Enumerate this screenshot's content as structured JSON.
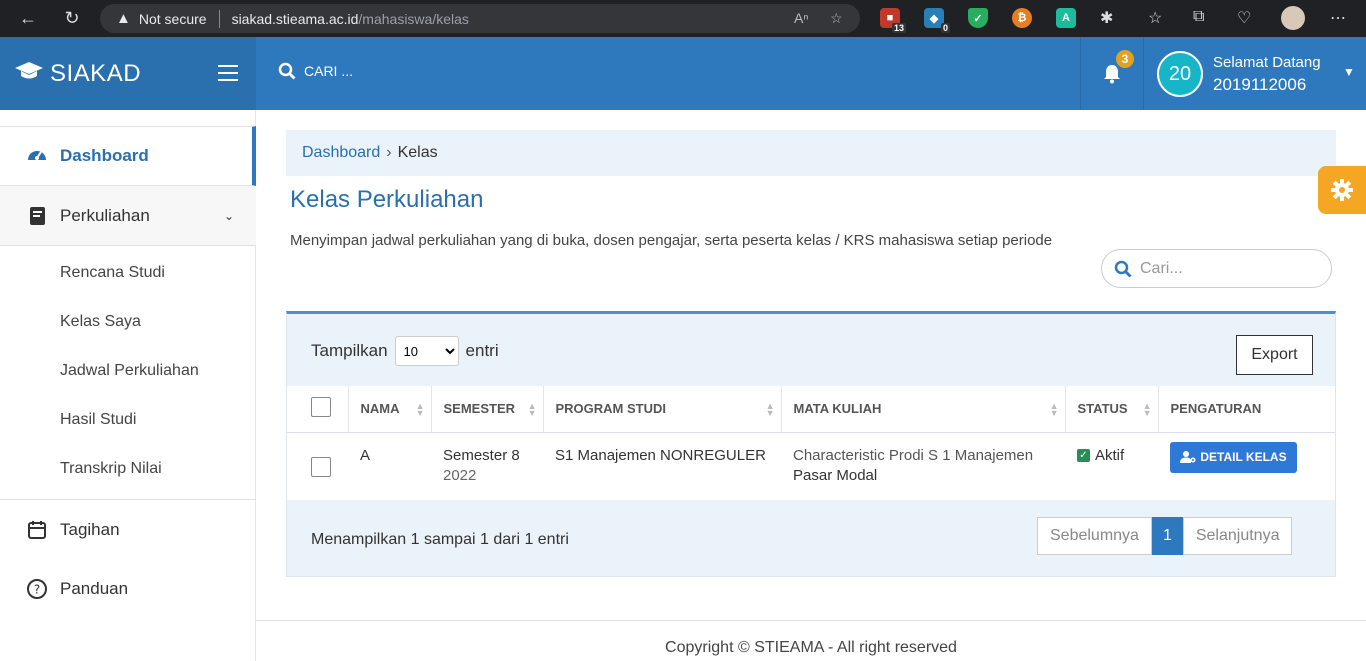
{
  "browser": {
    "not_secure": "Not secure",
    "host": "siakad.stieama.ac.id",
    "path": "/mahasiswa/kelas",
    "ext_badge_1": "13",
    "ext_badge_2": "0"
  },
  "header": {
    "brand": "SIAKAD",
    "search_placeholder": "CARI ...",
    "notif_count": "3",
    "avatar_text": "20",
    "greeting": "Selamat Datang",
    "user_id": "2019112006"
  },
  "sidebar": {
    "dashboard": "Dashboard",
    "perkuliahan": "Perkuliahan",
    "sub": [
      "Rencana Studi",
      "Kelas Saya",
      "Jadwal Perkuliahan",
      "Hasil Studi",
      "Transkrip Nilai"
    ],
    "tagihan": "Tagihan",
    "panduan": "Panduan"
  },
  "breadcrumb": {
    "home": "Dashboard",
    "sep": "›",
    "current": "Kelas"
  },
  "page": {
    "title": "Kelas Perkuliahan",
    "description": "Menyimpan jadwal perkuliahan yang di buka, dosen pengajar, serta peserta kelas / KRS mahasiswa setiap periode",
    "search_placeholder": "Cari..."
  },
  "table_controls": {
    "show_label": "Tampilkan",
    "show_value": "10",
    "entries_label": "entri",
    "export": "Export"
  },
  "table": {
    "headers": [
      "NAMA",
      "SEMESTER",
      "PROGRAM STUDI",
      "MATA KULIAH",
      "STATUS",
      "PENGATURAN"
    ],
    "rows": [
      {
        "nama": "A",
        "semester": "Semester 8",
        "tahun": "2022",
        "prodi": "S1 Manajemen NONREGULER",
        "mk_kode": "Characteristic Prodi S 1 Manajemen",
        "mk_nama": "Pasar Modal",
        "status": "Aktif",
        "action": "DETAIL KELAS"
      }
    ]
  },
  "footer_info": {
    "summary": "Menampilkan 1 sampai 1 dari 1 entri",
    "prev": "Sebelumnya",
    "page": "1",
    "next": "Selanjutnya"
  },
  "copyright": "Copyright © STIEAMA - All right reserved",
  "colors": {
    "primary": "#2e79bd",
    "accent": "#f5a623",
    "status_ok": "#2e8b57"
  }
}
